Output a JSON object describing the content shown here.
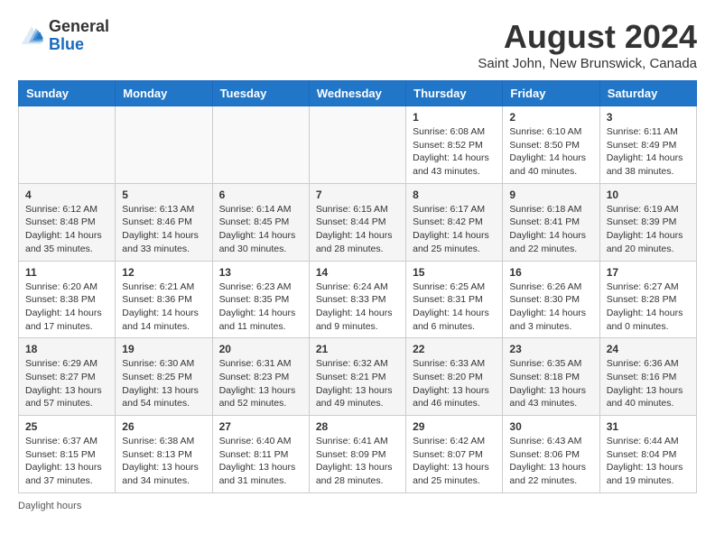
{
  "header": {
    "logo_line1": "General",
    "logo_line2": "Blue",
    "month_year": "August 2024",
    "location": "Saint John, New Brunswick, Canada"
  },
  "weekdays": [
    "Sunday",
    "Monday",
    "Tuesday",
    "Wednesday",
    "Thursday",
    "Friday",
    "Saturday"
  ],
  "weeks": [
    [
      {
        "day": "",
        "info": ""
      },
      {
        "day": "",
        "info": ""
      },
      {
        "day": "",
        "info": ""
      },
      {
        "day": "",
        "info": ""
      },
      {
        "day": "1",
        "info": "Sunrise: 6:08 AM\nSunset: 8:52 PM\nDaylight: 14 hours and 43 minutes."
      },
      {
        "day": "2",
        "info": "Sunrise: 6:10 AM\nSunset: 8:50 PM\nDaylight: 14 hours and 40 minutes."
      },
      {
        "day": "3",
        "info": "Sunrise: 6:11 AM\nSunset: 8:49 PM\nDaylight: 14 hours and 38 minutes."
      }
    ],
    [
      {
        "day": "4",
        "info": "Sunrise: 6:12 AM\nSunset: 8:48 PM\nDaylight: 14 hours and 35 minutes."
      },
      {
        "day": "5",
        "info": "Sunrise: 6:13 AM\nSunset: 8:46 PM\nDaylight: 14 hours and 33 minutes."
      },
      {
        "day": "6",
        "info": "Sunrise: 6:14 AM\nSunset: 8:45 PM\nDaylight: 14 hours and 30 minutes."
      },
      {
        "day": "7",
        "info": "Sunrise: 6:15 AM\nSunset: 8:44 PM\nDaylight: 14 hours and 28 minutes."
      },
      {
        "day": "8",
        "info": "Sunrise: 6:17 AM\nSunset: 8:42 PM\nDaylight: 14 hours and 25 minutes."
      },
      {
        "day": "9",
        "info": "Sunrise: 6:18 AM\nSunset: 8:41 PM\nDaylight: 14 hours and 22 minutes."
      },
      {
        "day": "10",
        "info": "Sunrise: 6:19 AM\nSunset: 8:39 PM\nDaylight: 14 hours and 20 minutes."
      }
    ],
    [
      {
        "day": "11",
        "info": "Sunrise: 6:20 AM\nSunset: 8:38 PM\nDaylight: 14 hours and 17 minutes."
      },
      {
        "day": "12",
        "info": "Sunrise: 6:21 AM\nSunset: 8:36 PM\nDaylight: 14 hours and 14 minutes."
      },
      {
        "day": "13",
        "info": "Sunrise: 6:23 AM\nSunset: 8:35 PM\nDaylight: 14 hours and 11 minutes."
      },
      {
        "day": "14",
        "info": "Sunrise: 6:24 AM\nSunset: 8:33 PM\nDaylight: 14 hours and 9 minutes."
      },
      {
        "day": "15",
        "info": "Sunrise: 6:25 AM\nSunset: 8:31 PM\nDaylight: 14 hours and 6 minutes."
      },
      {
        "day": "16",
        "info": "Sunrise: 6:26 AM\nSunset: 8:30 PM\nDaylight: 14 hours and 3 minutes."
      },
      {
        "day": "17",
        "info": "Sunrise: 6:27 AM\nSunset: 8:28 PM\nDaylight: 14 hours and 0 minutes."
      }
    ],
    [
      {
        "day": "18",
        "info": "Sunrise: 6:29 AM\nSunset: 8:27 PM\nDaylight: 13 hours and 57 minutes."
      },
      {
        "day": "19",
        "info": "Sunrise: 6:30 AM\nSunset: 8:25 PM\nDaylight: 13 hours and 54 minutes."
      },
      {
        "day": "20",
        "info": "Sunrise: 6:31 AM\nSunset: 8:23 PM\nDaylight: 13 hours and 52 minutes."
      },
      {
        "day": "21",
        "info": "Sunrise: 6:32 AM\nSunset: 8:21 PM\nDaylight: 13 hours and 49 minutes."
      },
      {
        "day": "22",
        "info": "Sunrise: 6:33 AM\nSunset: 8:20 PM\nDaylight: 13 hours and 46 minutes."
      },
      {
        "day": "23",
        "info": "Sunrise: 6:35 AM\nSunset: 8:18 PM\nDaylight: 13 hours and 43 minutes."
      },
      {
        "day": "24",
        "info": "Sunrise: 6:36 AM\nSunset: 8:16 PM\nDaylight: 13 hours and 40 minutes."
      }
    ],
    [
      {
        "day": "25",
        "info": "Sunrise: 6:37 AM\nSunset: 8:15 PM\nDaylight: 13 hours and 37 minutes."
      },
      {
        "day": "26",
        "info": "Sunrise: 6:38 AM\nSunset: 8:13 PM\nDaylight: 13 hours and 34 minutes."
      },
      {
        "day": "27",
        "info": "Sunrise: 6:40 AM\nSunset: 8:11 PM\nDaylight: 13 hours and 31 minutes."
      },
      {
        "day": "28",
        "info": "Sunrise: 6:41 AM\nSunset: 8:09 PM\nDaylight: 13 hours and 28 minutes."
      },
      {
        "day": "29",
        "info": "Sunrise: 6:42 AM\nSunset: 8:07 PM\nDaylight: 13 hours and 25 minutes."
      },
      {
        "day": "30",
        "info": "Sunrise: 6:43 AM\nSunset: 8:06 PM\nDaylight: 13 hours and 22 minutes."
      },
      {
        "day": "31",
        "info": "Sunrise: 6:44 AM\nSunset: 8:04 PM\nDaylight: 13 hours and 19 minutes."
      }
    ]
  ],
  "footer": "Daylight hours"
}
